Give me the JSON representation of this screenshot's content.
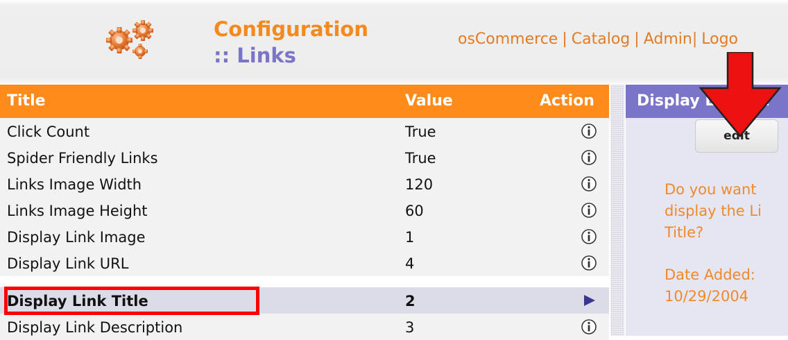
{
  "header": {
    "title_line1": "Configuration",
    "title_line2": ":: Links",
    "nav": [
      "osCommerce",
      "Catalog",
      "Admin",
      "Logo"
    ],
    "nav_separator": "|"
  },
  "table": {
    "columns": {
      "title": "Title",
      "value": "Value",
      "action": "Action"
    },
    "rows": [
      {
        "title": "Click Count",
        "value": "True",
        "action": "info-icon"
      },
      {
        "title": "Spider Friendly Links",
        "value": "True",
        "action": "info-icon"
      },
      {
        "title": "Links Image Width",
        "value": "120",
        "action": "info-icon"
      },
      {
        "title": "Links Image Height",
        "value": "60",
        "action": "info-icon"
      },
      {
        "title": "Display Link Image",
        "value": "1",
        "action": "info-icon"
      },
      {
        "title": "Display Link URL",
        "value": "4",
        "action": "info-icon"
      },
      {
        "title": "Display Link Title",
        "value": "2",
        "action": "arrow-icon",
        "selected": true
      },
      {
        "title": "Display Link Description",
        "value": "3",
        "action": "info-icon"
      }
    ]
  },
  "info_panel": {
    "heading": "Display Link Tit",
    "edit_label": "edit",
    "description_lines": [
      "Do you want",
      "display the Li",
      "Title?"
    ],
    "date_label": "Date Added:",
    "date_value": "10/29/2004"
  },
  "colors": {
    "orange": "#ff8a1c",
    "purple": "#7b75c9",
    "highlight_red": "#ff0000",
    "info_text": "#f0892a",
    "selected_row": "#dcdce8"
  }
}
